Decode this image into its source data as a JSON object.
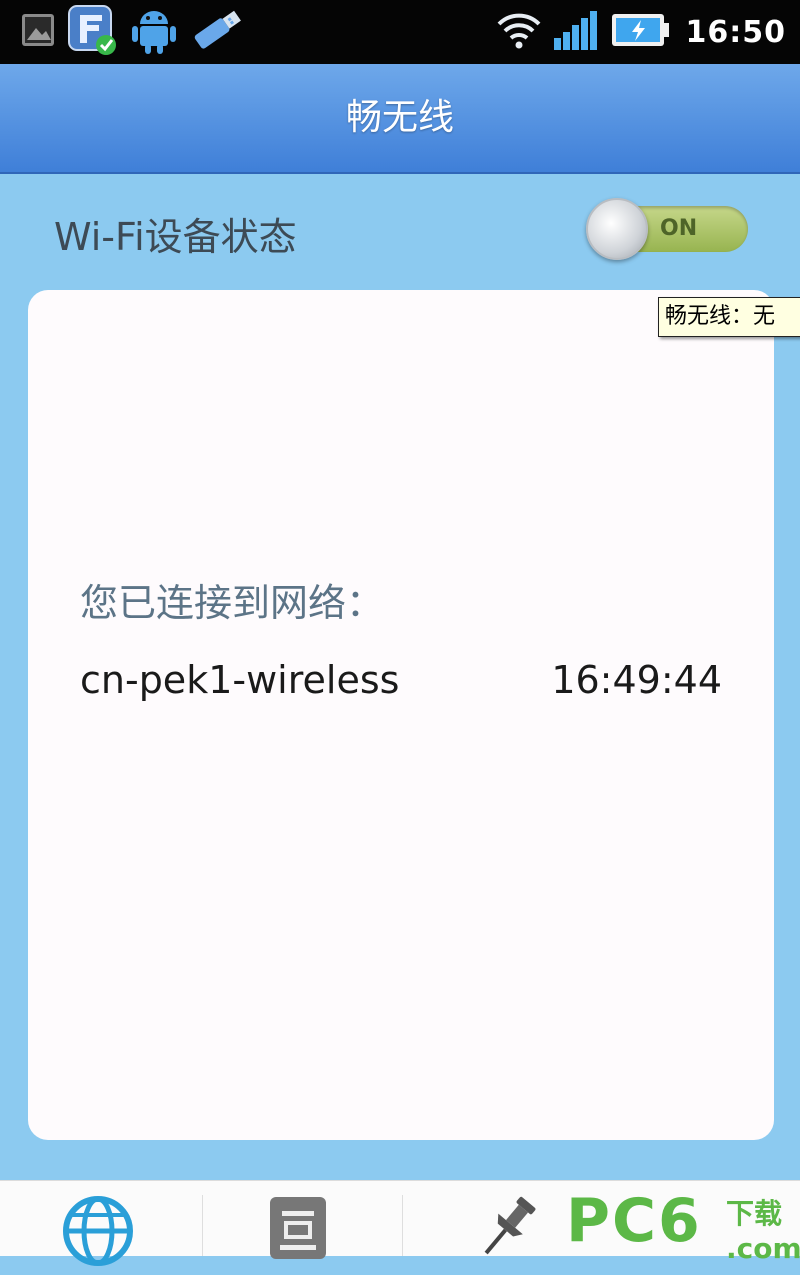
{
  "status_bar": {
    "icons_left": [
      "image-icon",
      "app-notification-icon",
      "android-icon",
      "usb-icon"
    ],
    "icons_right": [
      "wifi-icon",
      "signal-icon",
      "battery-charging-icon"
    ],
    "time": "16:50"
  },
  "header": {
    "title": "畅无线"
  },
  "wifi": {
    "label": "Wi-Fi设备状态",
    "toggle_state": "ON"
  },
  "tooltip": {
    "text": "畅无线：无"
  },
  "connection": {
    "label": "您已连接到网络：",
    "ssid": "cn-pek1-wireless",
    "time": "16:49:44"
  },
  "bottom_nav": {
    "items": [
      "globe-icon",
      "document-icon",
      "pin-icon"
    ],
    "watermark_main": "PC6",
    "watermark_sub": "下载",
    "watermark_domain": ".com"
  },
  "colors": {
    "background": "#8ccaf0",
    "header": "#4a88dc",
    "toggle_on": "#a8c060",
    "watermark": "#5cb847"
  }
}
